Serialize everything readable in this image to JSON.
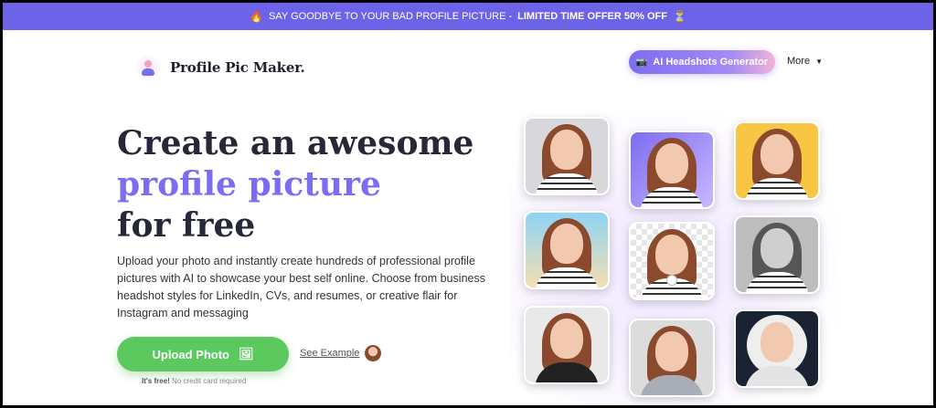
{
  "banner": {
    "icon_left": "🔥",
    "text": "SAY GOODBYE TO YOUR BAD PROFILE PICTURE - ",
    "offer": "LIMITED TIME OFFER 50% OFF",
    "icon_right": "⏳"
  },
  "nav": {
    "logo_text": "Profile Pic Maker.",
    "ai_button": "AI Headshots Generator",
    "more_label": "More"
  },
  "hero": {
    "title_line1": "Create an awesome",
    "title_accent": "profile picture",
    "title_line3": "for free",
    "description": "Upload your photo and instantly create hundreds of professional profile pictures with AI to showcase your best self online. Choose from business headshot styles for LinkedIn, CVs, and resumes, or creative flair for Instagram and messaging",
    "upload_button": "Upload Photo",
    "see_example": "See Example",
    "free_bold": "It's free!",
    "free_rest": "No credit card required"
  },
  "colors": {
    "banner_bg": "#6c63e8",
    "accent": "#7b6cf0",
    "upload_bg": "#5cc95e"
  }
}
